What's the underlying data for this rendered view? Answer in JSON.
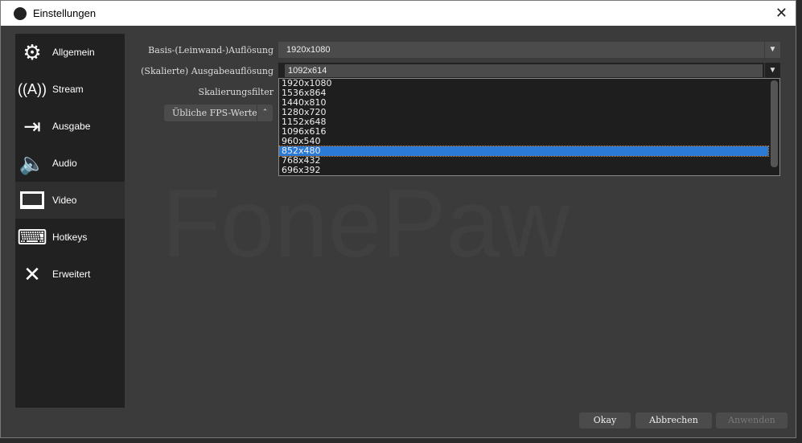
{
  "window": {
    "title": "Einstellungen"
  },
  "sidebar": {
    "items": [
      {
        "label": "Allgemein",
        "icon": "gear-icon"
      },
      {
        "label": "Stream",
        "icon": "antenna-icon"
      },
      {
        "label": "Ausgabe",
        "icon": "output-icon"
      },
      {
        "label": "Audio",
        "icon": "speaker-icon"
      },
      {
        "label": "Video",
        "icon": "monitor-icon",
        "active": true
      },
      {
        "label": "Hotkeys",
        "icon": "keyboard-icon"
      },
      {
        "label": "Erweitert",
        "icon": "tools-icon"
      }
    ]
  },
  "video": {
    "base_label": "Basis-(Leinwand-)Auflösung",
    "base_value": "1920x1080",
    "output_label": "(Skalierte) Ausgabeauflösung",
    "output_value": "1092x614",
    "filter_label": "Skalierungsfilter",
    "fps_label": "Übliche FPS-Werte",
    "options": [
      "1920x1080",
      "1536x864",
      "1440x810",
      "1280x720",
      "1152x648",
      "1096x616",
      "960x540",
      "852x480",
      "768x432",
      "696x392"
    ],
    "selected_option": "852x480"
  },
  "watermark": "FonePaw",
  "buttons": {
    "ok": "Okay",
    "cancel": "Abbrechen",
    "apply": "Anwenden"
  }
}
